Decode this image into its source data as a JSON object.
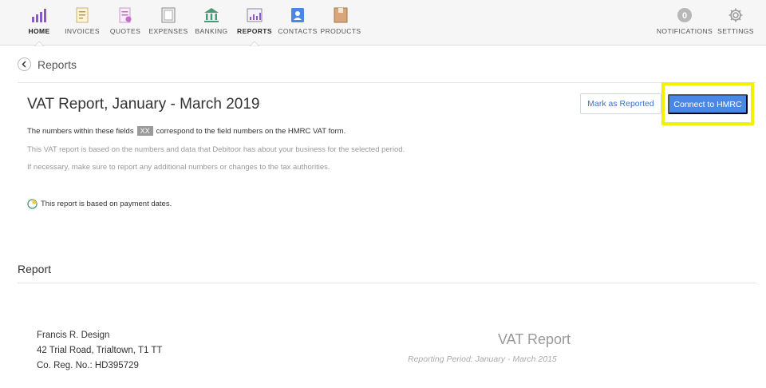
{
  "nav": {
    "items": [
      {
        "label": "HOME",
        "icon": "bar-chart-icon",
        "active": true
      },
      {
        "label": "INVOICES",
        "icon": "invoice-icon"
      },
      {
        "label": "QUOTES",
        "icon": "quote-icon"
      },
      {
        "label": "EXPENSES",
        "icon": "expenses-icon"
      },
      {
        "label": "BANKING",
        "icon": "bank-icon"
      },
      {
        "label": "REPORTS",
        "icon": "reports-icon"
      },
      {
        "label": "CONTACTS",
        "icon": "contacts-icon"
      },
      {
        "label": "PRODUCTS",
        "icon": "products-icon"
      }
    ],
    "notifications": {
      "label": "NOTIFICATIONS",
      "count": "0"
    },
    "settings": {
      "label": "SETTINGS"
    }
  },
  "breadcrumb": {
    "title": "Reports"
  },
  "header": {
    "title": "VAT Report, January - March 2019",
    "mark_label": "Mark as Reported",
    "connect_label": "Connect to HMRC"
  },
  "info": {
    "line1_pre": "The numbers within these fields",
    "line1_tag": "XX",
    "line1_post": "correspond to the field numbers on the HMRC VAT form.",
    "line2": "This VAT report is based on the numbers and data that Debitoor has about your business for the selected period.",
    "line3": "If necessary, make sure to report any additional numbers or changes to the tax authorities."
  },
  "payment_note": "This report is based on payment dates.",
  "report": {
    "section_title": "Report",
    "company_name": "Francis R. Design",
    "company_address": "42 Trial Road, Trialtown, T1 TT",
    "company_reg": "Co. Reg. No.: HD395729",
    "title": "VAT Report",
    "period": "Reporting Period: January - March 2015"
  },
  "colors": {
    "accent": "#4a88e8",
    "highlight": "#f2f200",
    "nav_purple": "#8a5cc9",
    "nav_green": "#4a9a7a"
  }
}
